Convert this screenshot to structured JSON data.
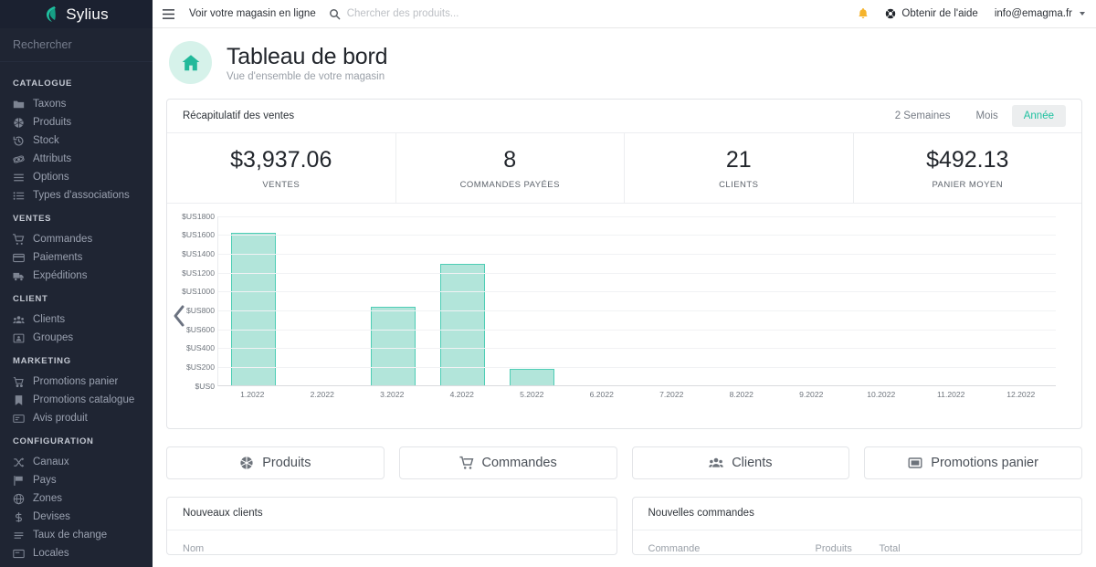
{
  "brand": {
    "name": "Sylius"
  },
  "sidebar": {
    "search_placeholder": "Rechercher",
    "groups": [
      {
        "title": "CATALOGUE",
        "items": [
          {
            "label": "Taxons",
            "icon": "folder-icon"
          },
          {
            "label": "Produits",
            "icon": "cube-icon"
          },
          {
            "label": "Stock",
            "icon": "history-icon"
          },
          {
            "label": "Attributs",
            "icon": "atom-icon"
          },
          {
            "label": "Options",
            "icon": "list-icon"
          },
          {
            "label": "Types d'associations",
            "icon": "list-ul-icon"
          }
        ]
      },
      {
        "title": "VENTES",
        "items": [
          {
            "label": "Commandes",
            "icon": "cart-icon"
          },
          {
            "label": "Paiements",
            "icon": "credit-card-icon"
          },
          {
            "label": "Expéditions",
            "icon": "truck-icon"
          }
        ]
      },
      {
        "title": "CLIENT",
        "items": [
          {
            "label": "Clients",
            "icon": "users-icon"
          },
          {
            "label": "Groupes",
            "icon": "group-icon"
          }
        ]
      },
      {
        "title": "MARKETING",
        "items": [
          {
            "label": "Promotions panier",
            "icon": "cart-promo-icon"
          },
          {
            "label": "Promotions catalogue",
            "icon": "bookmark-icon"
          },
          {
            "label": "Avis produit",
            "icon": "comment-icon"
          }
        ]
      },
      {
        "title": "CONFIGURATION",
        "items": [
          {
            "label": "Canaux",
            "icon": "shuffle-icon"
          },
          {
            "label": "Pays",
            "icon": "flag-icon"
          },
          {
            "label": "Zones",
            "icon": "globe-icon"
          },
          {
            "label": "Devises",
            "icon": "dollar-icon"
          },
          {
            "label": "Taux de change",
            "icon": "exchange-icon"
          },
          {
            "label": "Locales",
            "icon": "locale-icon"
          }
        ]
      }
    ]
  },
  "topbar": {
    "shop_link": "Voir votre magasin en ligne",
    "search_placeholder": "Chercher des produits...",
    "help_label": "Obtenir de l'aide",
    "user_email": "info@emagma.fr"
  },
  "page": {
    "title": "Tableau de bord",
    "subtitle": "Vue d'ensemble de votre magasin"
  },
  "sales_card": {
    "title": "Récapitulatif des ventes",
    "periods": [
      {
        "label": "2 Semaines",
        "active": false
      },
      {
        "label": "Mois",
        "active": false
      },
      {
        "label": "Année",
        "active": true
      }
    ],
    "stats": [
      {
        "value": "$3,937.06",
        "label": "VENTES"
      },
      {
        "value": "8",
        "label": "COMMANDES PAYÉES"
      },
      {
        "value": "21",
        "label": "CLIENTS"
      },
      {
        "value": "$492.13",
        "label": "PANIER MOYEN"
      }
    ]
  },
  "chart_data": {
    "type": "bar",
    "title": "Récapitulatif des ventes",
    "xlabel": "",
    "ylabel": "",
    "categories": [
      "1.2022",
      "2.2022",
      "3.2022",
      "4.2022",
      "5.2022",
      "6.2022",
      "7.2022",
      "8.2022",
      "9.2022",
      "10.2022",
      "11.2022",
      "12.2022"
    ],
    "values": [
      1610,
      0,
      830,
      1280,
      170,
      0,
      0,
      0,
      0,
      0,
      0,
      0
    ],
    "ylim": [
      0,
      1800
    ],
    "ytick_step": 200,
    "ytick_labels": [
      "$US0",
      "$US200",
      "$US400",
      "$US600",
      "$US800",
      "$US1000",
      "$US1200",
      "$US1400",
      "$US1600",
      "$US1800"
    ],
    "grid": true,
    "legend": false,
    "bar_fill": "#b2e5da",
    "bar_stroke": "#4ecdb5",
    "currency_prefix": "$US"
  },
  "shortcuts": [
    {
      "label": "Produits",
      "icon": "cube-icon"
    },
    {
      "label": "Commandes",
      "icon": "cart-icon"
    },
    {
      "label": "Clients",
      "icon": "users-icon"
    },
    {
      "label": "Promotions panier",
      "icon": "promo-icon"
    }
  ],
  "panels": {
    "new_customers": {
      "title": "Nouveaux clients",
      "columns": [
        "Nom"
      ]
    },
    "new_orders": {
      "title": "Nouvelles commandes",
      "columns": [
        "Commande",
        "Produits",
        "Total"
      ]
    }
  },
  "colors": {
    "accent": "#1fc1a0",
    "sidebar_bg": "#1f2533",
    "bar_fill": "#b2e5da",
    "bar_stroke": "#4ecdb5",
    "bell": "#f5b32b"
  }
}
